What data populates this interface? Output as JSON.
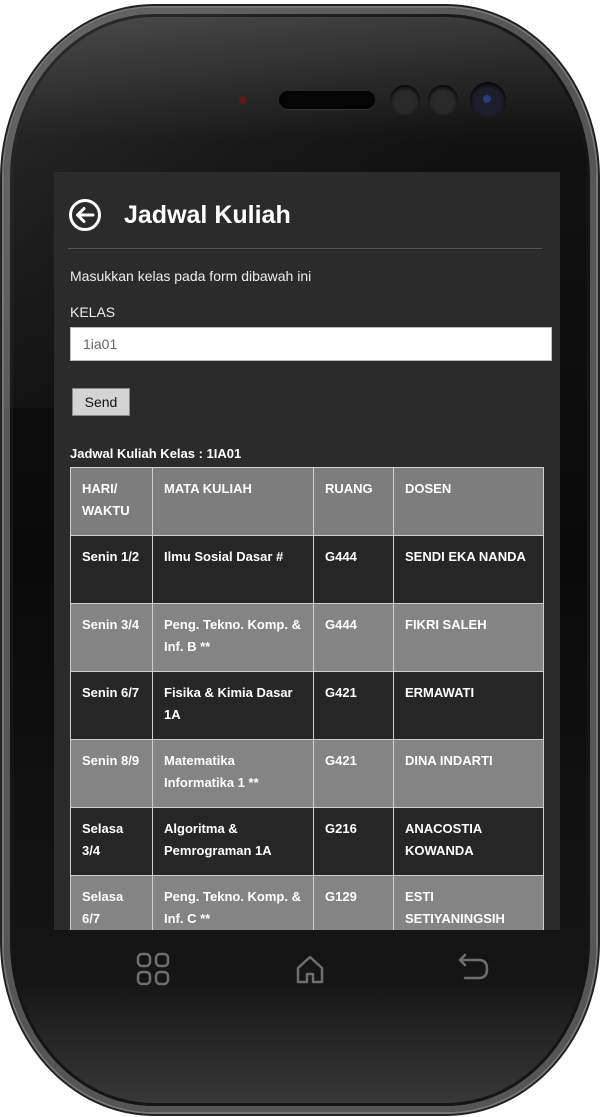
{
  "header": {
    "title": "Jadwal Kuliah"
  },
  "form": {
    "instruction": "Masukkan kelas pada form dibawah ini",
    "kelas_label": "KELAS",
    "kelas_value": "1ia01",
    "send_label": "Send"
  },
  "schedule": {
    "title": "Jadwal Kuliah Kelas : 1IA01",
    "columns": [
      "HARI/ WAKTU",
      "MATA KULIAH",
      "RUANG",
      "DOSEN"
    ],
    "rows": [
      [
        "Senin 1/2",
        "Ilmu Sosial Dasar #",
        "G444",
        "SENDI EKA NANDA"
      ],
      [
        "Senin 3/4",
        "Peng. Tekno. Komp. & Inf. B **",
        "G444",
        "FIKRI SALEH"
      ],
      [
        "Senin 6/7",
        "Fisika & Kimia Dasar 1A",
        "G421",
        "ERMAWATI"
      ],
      [
        "Senin 8/9",
        "Matematika Informatika 1 **",
        "G421",
        "DINA INDARTI"
      ],
      [
        "Selasa 3/4",
        "Algoritma & Pemrograman 1A",
        "G216",
        "ANACOSTIA KOWANDA"
      ],
      [
        "Selasa 6/7",
        "Peng. Tekno. Komp. & Inf. C **",
        "G129",
        "ESTI SETIYANINGSIH"
      ]
    ]
  },
  "navigation": {
    "icons": [
      "apps-grid-icon",
      "home-icon",
      "back-arrow-icon"
    ]
  },
  "colors": {
    "screen_background": "#2b2b2b",
    "header_row": "#7d7d7d",
    "row_dark": "#262626",
    "row_light": "#848484",
    "input_background": "#ffffff"
  }
}
